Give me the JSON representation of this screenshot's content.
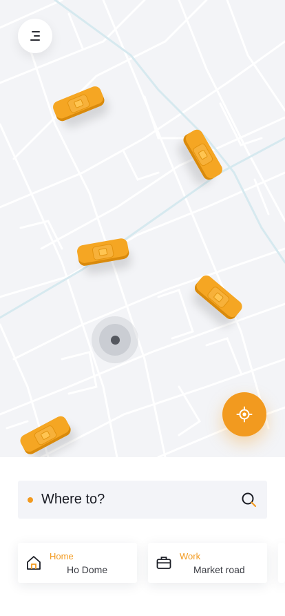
{
  "map": {
    "menu_icon": "menu-lines-icon",
    "vehicle_icon": "taxi-icon",
    "locate_icon": "crosshair-icon",
    "accent": "#f29a1f",
    "taxi_color": "#f5a623",
    "road_color": "#ffffff",
    "main_road_color": "#d6e9ef",
    "background": "#f3f4f7"
  },
  "search": {
    "placeholder": "Where to?",
    "icon": "search-icon"
  },
  "saved_places": [
    {
      "label": "Home",
      "address": "Ho Dome",
      "icon": "home-icon"
    },
    {
      "label": "Work",
      "address": "Market road",
      "icon": "briefcase-icon"
    }
  ]
}
